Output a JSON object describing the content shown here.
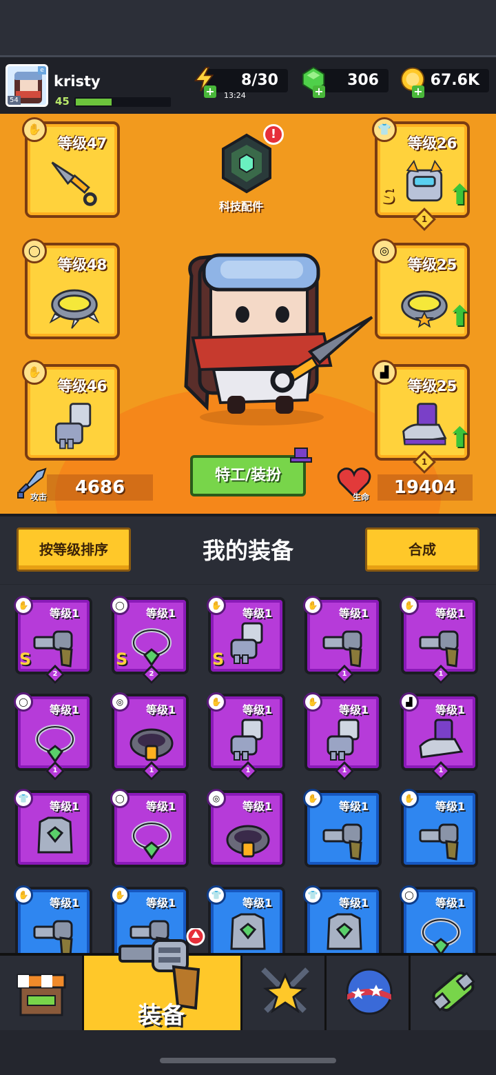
{
  "player": {
    "name": "kristy",
    "level": "45",
    "avatar_tag": "54",
    "xp_fraction": 0.38
  },
  "resources": {
    "energy": "8/30",
    "energy_timer": "13:24",
    "gems": "306",
    "coins": "67.6K"
  },
  "equipped": {
    "weapon": {
      "level": "等级47"
    },
    "necklace": {
      "level": "等级48"
    },
    "gloves": {
      "level": "等级46"
    },
    "armor": {
      "level": "等级26",
      "rank": "S",
      "count": "1"
    },
    "ring": {
      "level": "等级25"
    },
    "boots": {
      "level": "等级25",
      "count": "1"
    }
  },
  "tech": {
    "label": "科技配件"
  },
  "agent_button": "特工/装扮",
  "stats": {
    "attack_label": "攻击",
    "attack_value": "4686",
    "hp_label": "生命",
    "hp_value": "19404"
  },
  "gear_header": {
    "sort_button": "按等级排序",
    "title": "我的装备",
    "merge_button": "合成"
  },
  "inventory": [
    {
      "level": "等级1",
      "rarity": "purple",
      "icon": "weapon-icon",
      "rank": "S",
      "count": "2"
    },
    {
      "level": "等级1",
      "rarity": "purple",
      "icon": "necklace-icon",
      "rank": "S",
      "count": "2"
    },
    {
      "level": "等级1",
      "rarity": "purple",
      "icon": "glove-icon",
      "rank": "S",
      "count": ""
    },
    {
      "level": "等级1",
      "rarity": "purple",
      "icon": "weapon-icon",
      "rank": "",
      "count": "1"
    },
    {
      "level": "等级1",
      "rarity": "purple",
      "icon": "weapon-icon",
      "rank": "",
      "count": "1"
    },
    {
      "level": "等级1",
      "rarity": "purple",
      "icon": "necklace-icon",
      "rank": "",
      "count": "1"
    },
    {
      "level": "等级1",
      "rarity": "purple",
      "icon": "belt-icon",
      "rank": "",
      "count": "1"
    },
    {
      "level": "等级1",
      "rarity": "purple",
      "icon": "glove-icon",
      "rank": "",
      "count": "1"
    },
    {
      "level": "等级1",
      "rarity": "purple",
      "icon": "glove-icon",
      "rank": "",
      "count": "1"
    },
    {
      "level": "等级1",
      "rarity": "purple",
      "icon": "boot-icon",
      "rank": "",
      "count": "1"
    },
    {
      "level": "等级1",
      "rarity": "purple",
      "icon": "armor-icon",
      "rank": "",
      "count": ""
    },
    {
      "level": "等级1",
      "rarity": "purple",
      "icon": "necklace-icon",
      "rank": "",
      "count": ""
    },
    {
      "level": "等级1",
      "rarity": "purple",
      "icon": "belt-icon",
      "rank": "",
      "count": ""
    },
    {
      "level": "等级1",
      "rarity": "blue",
      "icon": "weapon-icon",
      "rank": "",
      "count": ""
    },
    {
      "level": "等级1",
      "rarity": "blue",
      "icon": "weapon-icon",
      "rank": "",
      "count": ""
    },
    {
      "level": "等级1",
      "rarity": "blue",
      "icon": "weapon-icon",
      "rank": "",
      "count": ""
    },
    {
      "level": "等级1",
      "rarity": "blue",
      "icon": "weapon-icon",
      "rank": "",
      "count": ""
    },
    {
      "level": "等级1",
      "rarity": "blue",
      "icon": "armor-icon",
      "rank": "",
      "count": ""
    },
    {
      "level": "等级1",
      "rarity": "blue",
      "icon": "armor-icon",
      "rank": "",
      "count": ""
    },
    {
      "level": "等级1",
      "rarity": "blue",
      "icon": "necklace-icon",
      "rank": "",
      "count": ""
    }
  ],
  "nav": {
    "active_label": "装备"
  },
  "colors": {
    "stage": "#f29a1e",
    "slot": "#ffd23c",
    "purple": "#b63bd9",
    "blue": "#2f86f0",
    "button_green": "#78d54a",
    "button_yellow": "#ffc829"
  }
}
